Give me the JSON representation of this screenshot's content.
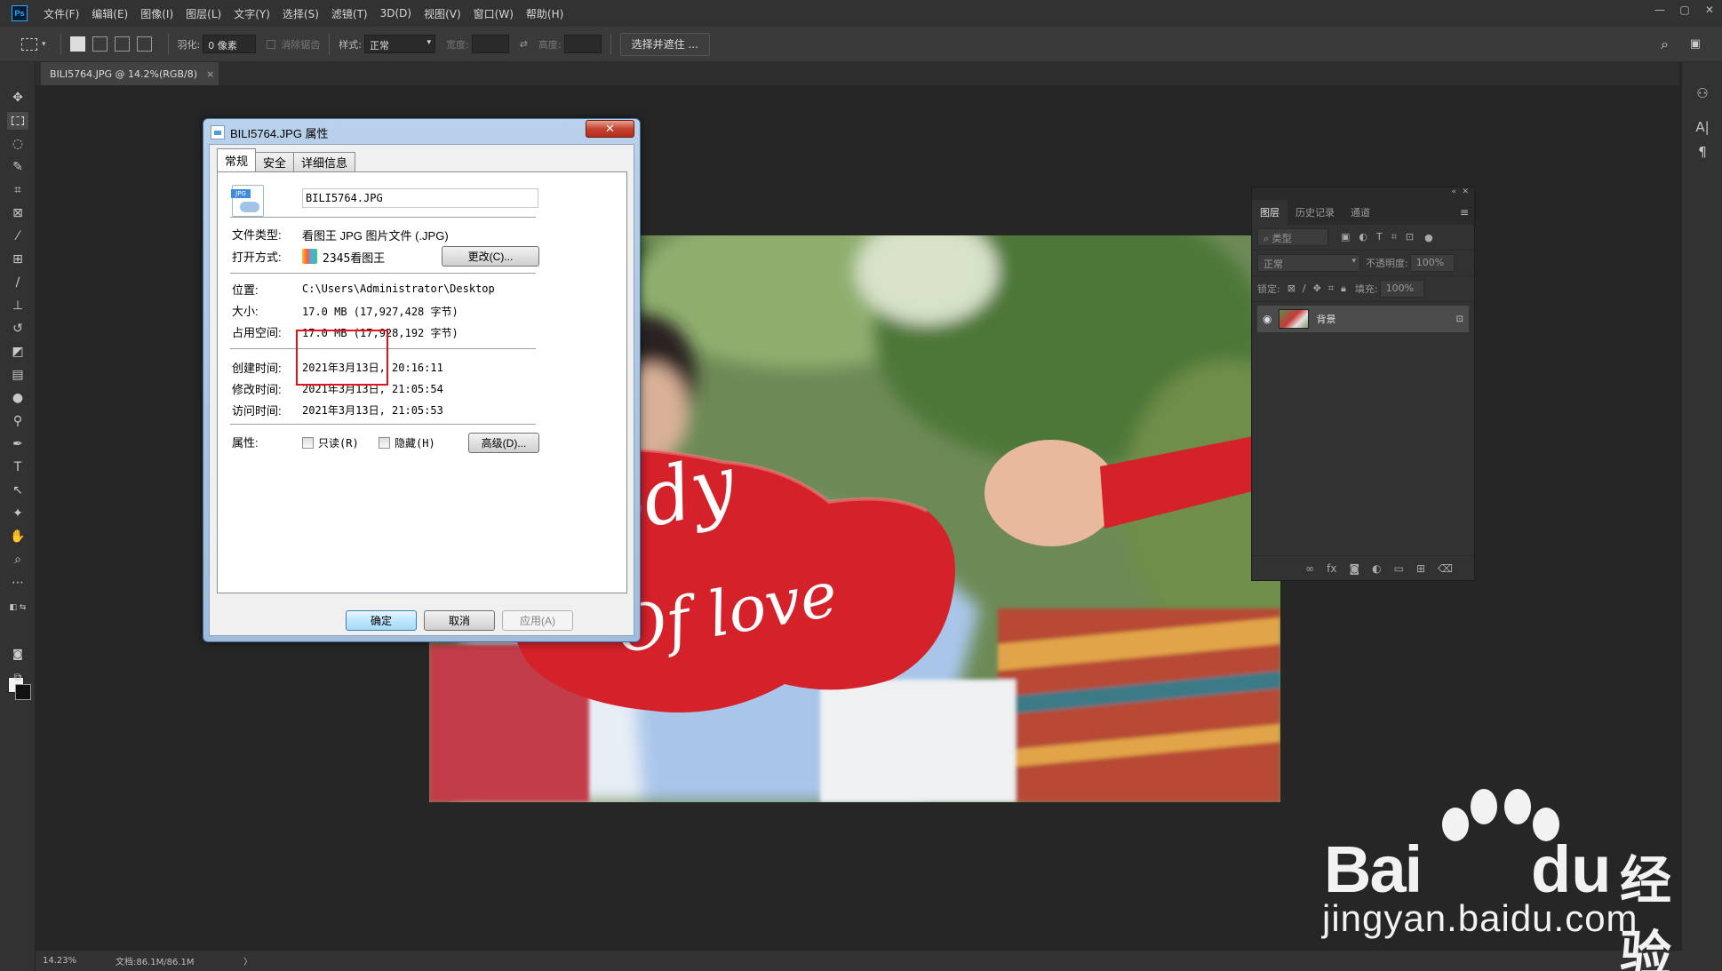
{
  "menubar": {
    "logo": "Ps",
    "items": [
      "文件(F)",
      "编辑(E)",
      "图像(I)",
      "图层(L)",
      "文字(Y)",
      "选择(S)",
      "滤镜(T)",
      "3D(D)",
      "视图(V)",
      "窗口(W)",
      "帮助(H)"
    ]
  },
  "options": {
    "feather_label": "羽化:",
    "feather_value": "0 像素",
    "antialias_label": "消除锯齿",
    "style_label": "样式:",
    "style_value": "正常",
    "width_label": "宽度:",
    "height_label": "高度:",
    "select_mask_button": "选择并遮住 ..."
  },
  "document": {
    "tab_title": "BILI5764.JPG @ 14.2%(RGB/8)",
    "tab_close": "×"
  },
  "canvas_image": {
    "line1": "elody",
    "line2": "Of love"
  },
  "layers_panel": {
    "tabs": [
      "图层",
      "历史记录",
      "通道"
    ],
    "filter_placeholder": "类型",
    "blend_mode": "正常",
    "opacity_label": "不透明度:",
    "opacity_value": "100%",
    "lock_label": "锁定:",
    "fill_label": "填充:",
    "fill_value": "100%",
    "layer_name": "背景"
  },
  "dialog": {
    "title": "BILI5764.JPG 属性",
    "close": "✕",
    "tabs": [
      "常规",
      "安全",
      "详细信息"
    ],
    "filename": "BILI5764.JPG",
    "file_type_label": "文件类型:",
    "file_type_value": "看图王 JPG 图片文件 (.JPG)",
    "open_with_label": "打开方式:",
    "open_with_value": "2345看图王",
    "change_button": "更改(C)...",
    "location_label": "位置:",
    "location_value": "C:\\Users\\Administrator\\Desktop",
    "size_label": "大小:",
    "size_value": "17.0 MB (17,927,428 字节)",
    "disk_label": "占用空间:",
    "disk_value": "17.0 MB (17,928,192 字节)",
    "created_label": "创建时间:",
    "created_value": "2021年3月13日, 20:16:11",
    "modified_label": "修改时间:",
    "modified_value": "2021年3月13日, 21:05:54",
    "accessed_label": "访问时间:",
    "accessed_value": "2021年3月13日, 21:05:53",
    "attributes_label": "属性:",
    "readonly_label": "只读(R)",
    "hidden_label": "隐藏(H)",
    "advanced_button": "高级(D)...",
    "ok_button": "确定",
    "cancel_button": "取消",
    "apply_button": "应用(A)"
  },
  "status": {
    "zoom": "14.23%",
    "doc_size": "文档:86.1M/86.1M",
    "arrow": "〉"
  },
  "watermark": {
    "bai": "Bai",
    "du": "du",
    "jingyan": "经验",
    "url": "jingyan.baidu.com"
  },
  "colors": {
    "ps_bg": "#262626",
    "panel_bg": "#323232",
    "highlight_red": "#e4141b",
    "guitar_red": "#d4212a"
  }
}
